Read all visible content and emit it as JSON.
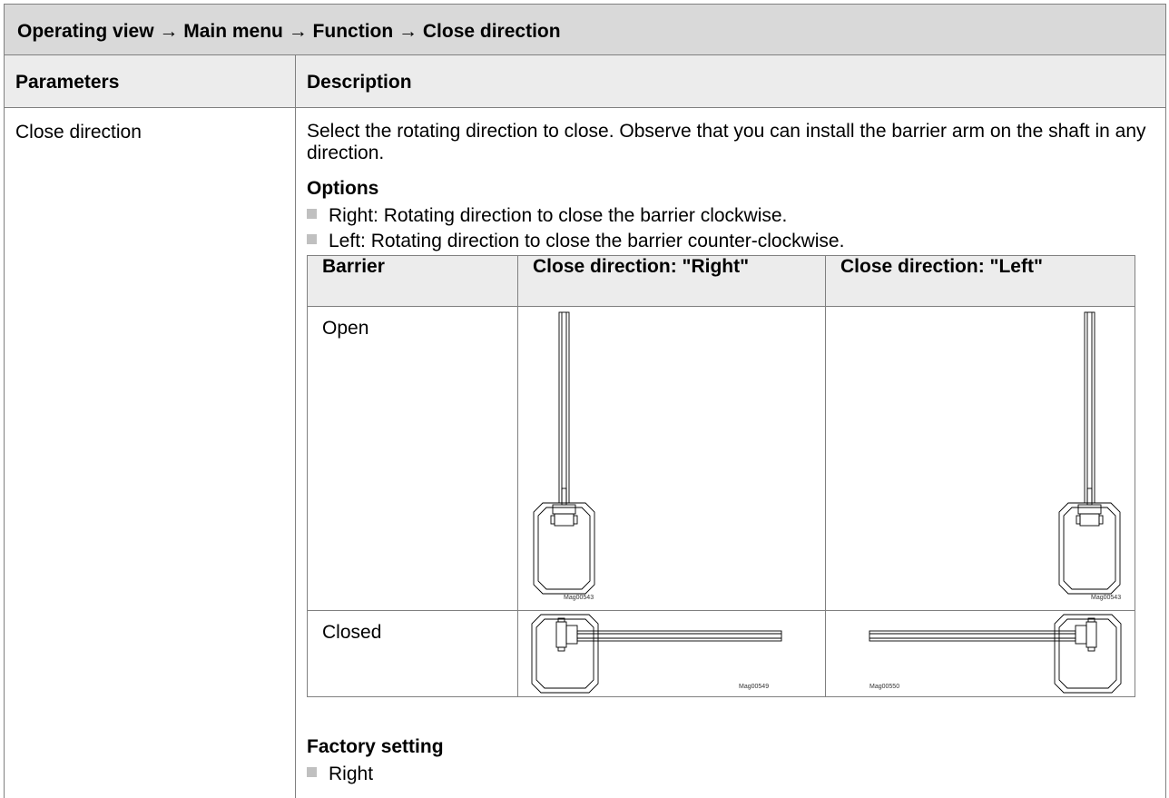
{
  "header": {
    "breadcrumb": "Operating view → Main menu → Function → Close direction"
  },
  "columns": {
    "parameters": "Parameters",
    "description": "Description"
  },
  "parameter": {
    "name": "Close direction",
    "description": "Select the rotating direction to close. Observe that you can install the barrier arm on the shaft in any direction.",
    "options_title": "Options",
    "options": [
      "Right: Rotating direction to close the barrier clockwise.",
      "Left: Rotating direction to close the barrier counter-clockwise."
    ],
    "table": {
      "headers": [
        "Barrier",
        "Close direction: \"Right\"",
        "Close direction: \"Left\""
      ],
      "rows": [
        {
          "label": "Open",
          "fig_right": "Mag00543",
          "fig_left": "Mag00543"
        },
        {
          "label": "Closed",
          "fig_right": "Mag00549",
          "fig_left": "Mag00550"
        }
      ]
    },
    "factory_title": "Factory setting",
    "factory_value": "Right"
  }
}
